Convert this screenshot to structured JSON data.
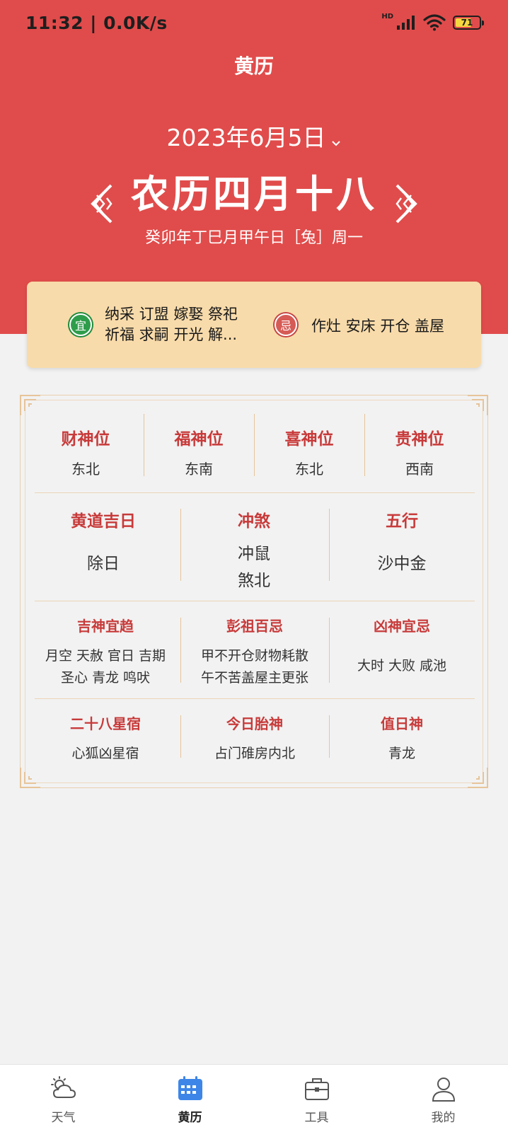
{
  "status_bar": {
    "time": "11:32 | 0.0K/s",
    "network": "HD",
    "battery": "71"
  },
  "header": {
    "title": "黄历"
  },
  "date": {
    "solar": "2023年6月5日",
    "lunar": "农历四月十八",
    "ganzhi": "癸卯年丁巳月甲午日［兔］周一"
  },
  "yiji": {
    "yi_label": "宜",
    "yi_text_line1": "纳采 订盟 嫁娶 祭祀",
    "yi_text_line2": "祈福 求嗣 开光 解...",
    "ji_label": "忌",
    "ji_text": "作灶 安床 开仓 盖屋"
  },
  "almanac": {
    "row1": [
      {
        "label": "财神位",
        "value": "东北"
      },
      {
        "label": "福神位",
        "value": "东南"
      },
      {
        "label": "喜神位",
        "value": "东北"
      },
      {
        "label": "贵神位",
        "value": "西南"
      }
    ],
    "row2": [
      {
        "label": "黄道吉日",
        "value": "除日"
      },
      {
        "label": "冲煞",
        "value1": "冲鼠",
        "value2": "煞北"
      },
      {
        "label": "五行",
        "value": "沙中金"
      }
    ],
    "row3": [
      {
        "label": "吉神宜趋",
        "value1": "月空 天赦 官日 吉期",
        "value2": "圣心 青龙 鸣吠"
      },
      {
        "label": "彭祖百忌",
        "value1": "甲不开仓财物耗散",
        "value2": "午不苦盖屋主更张"
      },
      {
        "label": "凶神宜忌",
        "value": "大时 大败 咸池"
      }
    ],
    "row4": [
      {
        "label": "二十八星宿",
        "value": "心狐凶星宿"
      },
      {
        "label": "今日胎神",
        "value": "占门碓房内北"
      },
      {
        "label": "值日神",
        "value": "青龙"
      }
    ]
  },
  "tabs": [
    {
      "label": "天气",
      "icon": "weather-icon"
    },
    {
      "label": "黄历",
      "icon": "calendar-icon",
      "active": true
    },
    {
      "label": "工具",
      "icon": "toolbox-icon"
    },
    {
      "label": "我的",
      "icon": "profile-icon"
    }
  ],
  "colors": {
    "hero": "#e04c4b",
    "card": "#f8dbaa",
    "accent": "#c83a3a",
    "tab_active": "#3d86e8"
  }
}
